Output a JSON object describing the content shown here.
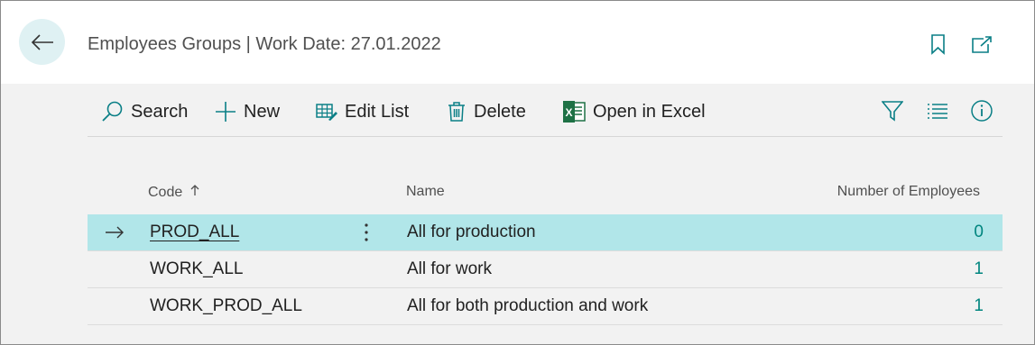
{
  "header": {
    "title": "Employees Groups | Work Date: 27.01.2022"
  },
  "toolbar": {
    "search_label": "Search",
    "new_label": "New",
    "edit_list_label": "Edit List",
    "delete_label": "Delete",
    "open_excel_label": "Open in Excel"
  },
  "table": {
    "columns": {
      "code": "Code",
      "name": "Name",
      "employees": "Number of Employees"
    },
    "rows": [
      {
        "code": "PROD_ALL",
        "name": "All for production",
        "employees": "0"
      },
      {
        "code": "WORK_ALL",
        "name": "All for work",
        "employees": "1"
      },
      {
        "code": "WORK_PROD_ALL",
        "name": "All for both production and work",
        "employees": "1"
      }
    ]
  },
  "colors": {
    "accent": "#00857f",
    "selected_row": "#b1e6e9",
    "back_button_bg": "#dff1f3"
  },
  "icons": [
    "back-arrow-icon",
    "bookmark-icon",
    "open-new-window-icon",
    "search-icon",
    "plus-icon",
    "edit-list-icon",
    "trash-icon",
    "excel-icon",
    "filter-icon",
    "list-view-icon",
    "info-icon",
    "sort-ascending-icon",
    "row-arrow-icon",
    "more-options-icon"
  ]
}
